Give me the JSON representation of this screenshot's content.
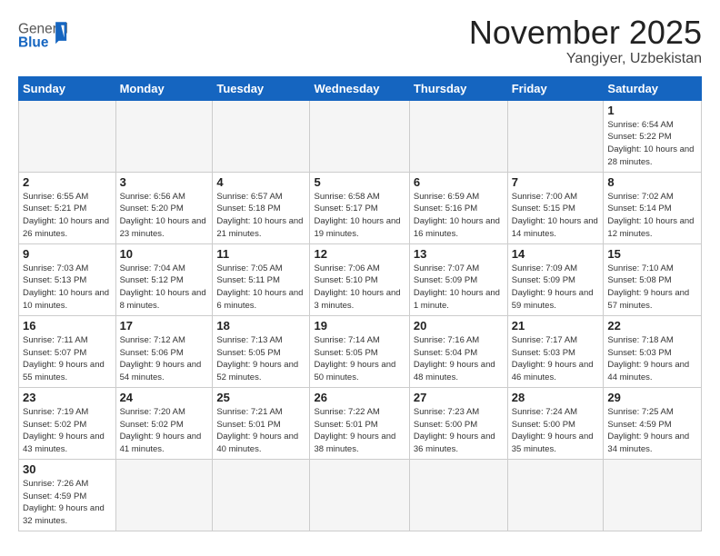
{
  "header": {
    "title": "November 2025",
    "subtitle": "Yangiyer, Uzbekistan",
    "logo_general": "General",
    "logo_blue": "Blue"
  },
  "days_of_week": [
    "Sunday",
    "Monday",
    "Tuesday",
    "Wednesday",
    "Thursday",
    "Friday",
    "Saturday"
  ],
  "weeks": [
    [
      {
        "day": "",
        "info": ""
      },
      {
        "day": "",
        "info": ""
      },
      {
        "day": "",
        "info": ""
      },
      {
        "day": "",
        "info": ""
      },
      {
        "day": "",
        "info": ""
      },
      {
        "day": "",
        "info": ""
      },
      {
        "day": "1",
        "info": "Sunrise: 6:54 AM\nSunset: 5:22 PM\nDaylight: 10 hours and 28 minutes."
      }
    ],
    [
      {
        "day": "2",
        "info": "Sunrise: 6:55 AM\nSunset: 5:21 PM\nDaylight: 10 hours and 26 minutes."
      },
      {
        "day": "3",
        "info": "Sunrise: 6:56 AM\nSunset: 5:20 PM\nDaylight: 10 hours and 23 minutes."
      },
      {
        "day": "4",
        "info": "Sunrise: 6:57 AM\nSunset: 5:18 PM\nDaylight: 10 hours and 21 minutes."
      },
      {
        "day": "5",
        "info": "Sunrise: 6:58 AM\nSunset: 5:17 PM\nDaylight: 10 hours and 19 minutes."
      },
      {
        "day": "6",
        "info": "Sunrise: 6:59 AM\nSunset: 5:16 PM\nDaylight: 10 hours and 16 minutes."
      },
      {
        "day": "7",
        "info": "Sunrise: 7:00 AM\nSunset: 5:15 PM\nDaylight: 10 hours and 14 minutes."
      },
      {
        "day": "8",
        "info": "Sunrise: 7:02 AM\nSunset: 5:14 PM\nDaylight: 10 hours and 12 minutes."
      }
    ],
    [
      {
        "day": "9",
        "info": "Sunrise: 7:03 AM\nSunset: 5:13 PM\nDaylight: 10 hours and 10 minutes."
      },
      {
        "day": "10",
        "info": "Sunrise: 7:04 AM\nSunset: 5:12 PM\nDaylight: 10 hours and 8 minutes."
      },
      {
        "day": "11",
        "info": "Sunrise: 7:05 AM\nSunset: 5:11 PM\nDaylight: 10 hours and 6 minutes."
      },
      {
        "day": "12",
        "info": "Sunrise: 7:06 AM\nSunset: 5:10 PM\nDaylight: 10 hours and 3 minutes."
      },
      {
        "day": "13",
        "info": "Sunrise: 7:07 AM\nSunset: 5:09 PM\nDaylight: 10 hours and 1 minute."
      },
      {
        "day": "14",
        "info": "Sunrise: 7:09 AM\nSunset: 5:09 PM\nDaylight: 9 hours and 59 minutes."
      },
      {
        "day": "15",
        "info": "Sunrise: 7:10 AM\nSunset: 5:08 PM\nDaylight: 9 hours and 57 minutes."
      }
    ],
    [
      {
        "day": "16",
        "info": "Sunrise: 7:11 AM\nSunset: 5:07 PM\nDaylight: 9 hours and 55 minutes."
      },
      {
        "day": "17",
        "info": "Sunrise: 7:12 AM\nSunset: 5:06 PM\nDaylight: 9 hours and 54 minutes."
      },
      {
        "day": "18",
        "info": "Sunrise: 7:13 AM\nSunset: 5:05 PM\nDaylight: 9 hours and 52 minutes."
      },
      {
        "day": "19",
        "info": "Sunrise: 7:14 AM\nSunset: 5:05 PM\nDaylight: 9 hours and 50 minutes."
      },
      {
        "day": "20",
        "info": "Sunrise: 7:16 AM\nSunset: 5:04 PM\nDaylight: 9 hours and 48 minutes."
      },
      {
        "day": "21",
        "info": "Sunrise: 7:17 AM\nSunset: 5:03 PM\nDaylight: 9 hours and 46 minutes."
      },
      {
        "day": "22",
        "info": "Sunrise: 7:18 AM\nSunset: 5:03 PM\nDaylight: 9 hours and 44 minutes."
      }
    ],
    [
      {
        "day": "23",
        "info": "Sunrise: 7:19 AM\nSunset: 5:02 PM\nDaylight: 9 hours and 43 minutes."
      },
      {
        "day": "24",
        "info": "Sunrise: 7:20 AM\nSunset: 5:02 PM\nDaylight: 9 hours and 41 minutes."
      },
      {
        "day": "25",
        "info": "Sunrise: 7:21 AM\nSunset: 5:01 PM\nDaylight: 9 hours and 40 minutes."
      },
      {
        "day": "26",
        "info": "Sunrise: 7:22 AM\nSunset: 5:01 PM\nDaylight: 9 hours and 38 minutes."
      },
      {
        "day": "27",
        "info": "Sunrise: 7:23 AM\nSunset: 5:00 PM\nDaylight: 9 hours and 36 minutes."
      },
      {
        "day": "28",
        "info": "Sunrise: 7:24 AM\nSunset: 5:00 PM\nDaylight: 9 hours and 35 minutes."
      },
      {
        "day": "29",
        "info": "Sunrise: 7:25 AM\nSunset: 4:59 PM\nDaylight: 9 hours and 34 minutes."
      }
    ],
    [
      {
        "day": "30",
        "info": "Sunrise: 7:26 AM\nSunset: 4:59 PM\nDaylight: 9 hours and 32 minutes."
      },
      {
        "day": "",
        "info": ""
      },
      {
        "day": "",
        "info": ""
      },
      {
        "day": "",
        "info": ""
      },
      {
        "day": "",
        "info": ""
      },
      {
        "day": "",
        "info": ""
      },
      {
        "day": "",
        "info": ""
      }
    ]
  ]
}
